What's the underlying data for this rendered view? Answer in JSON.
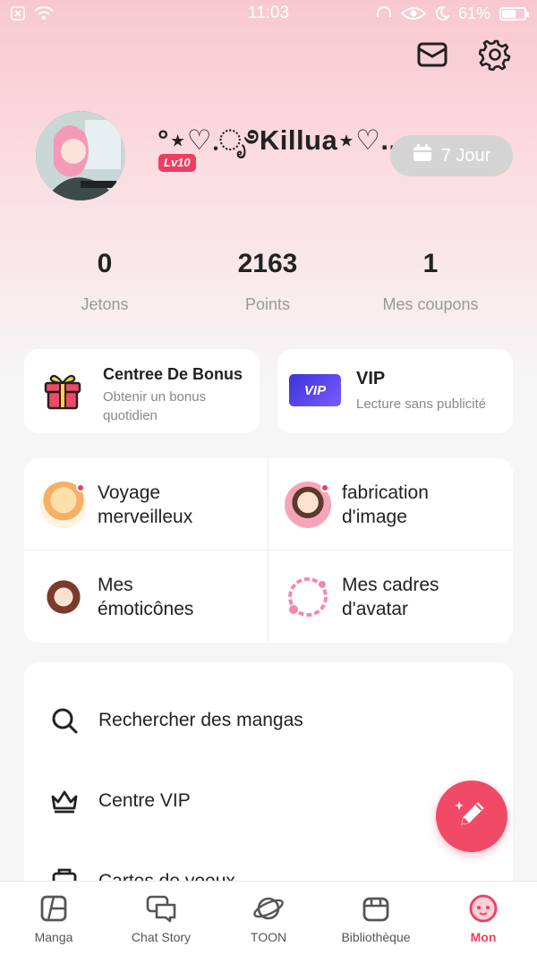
{
  "status_bar": {
    "time": "11:03",
    "battery": "61%",
    "battery_level": 0.61
  },
  "header": {
    "icons": [
      "mail-icon",
      "gear-icon"
    ]
  },
  "profile": {
    "username": "°⋆♡.ೃ࿔Killua⋆♡...",
    "level": "Lv10",
    "checkin_label": "7 Jour"
  },
  "stats": [
    {
      "value": "0",
      "label": "Jetons"
    },
    {
      "value": "2163",
      "label": "Points"
    },
    {
      "value": "1",
      "label": "Mes coupons"
    }
  ],
  "cards": {
    "bonus": {
      "title": "Centree De Bonus",
      "subtitle": "Obtenir un bonus quotidien"
    },
    "vip": {
      "title": "VIP",
      "subtitle": "Lecture sans publicité",
      "badge": "VIP"
    }
  },
  "features": [
    {
      "label_line1": "Voyage",
      "label_line2": "merveilleux"
    },
    {
      "label_line1": "fabrication",
      "label_line2": "d'image"
    },
    {
      "label_line1": "Mes",
      "label_line2": "émoticônes"
    },
    {
      "label_line1": "Mes cadres",
      "label_line2": "d'avatar"
    }
  ],
  "menu": [
    {
      "label": "Rechercher des mangas",
      "icon": "search-icon"
    },
    {
      "label": "Centre VIP",
      "icon": "crown-icon"
    },
    {
      "label": "Cartes de voeux",
      "icon": "card-icon"
    }
  ],
  "nav": [
    {
      "label": "Manga",
      "icon": "manga-icon"
    },
    {
      "label": "Chat Story",
      "icon": "chat-icon"
    },
    {
      "label": "TOON",
      "icon": "planet-icon"
    },
    {
      "label": "Bibliothèque",
      "icon": "library-icon"
    },
    {
      "label": "Mon",
      "icon": "profile-face-icon",
      "active": true
    }
  ],
  "colors": {
    "accent": "#ee3d62",
    "header_gradient_top": "#f8c8d0",
    "background": "#f6f6f7",
    "vip_badge": "#5b3df0"
  }
}
